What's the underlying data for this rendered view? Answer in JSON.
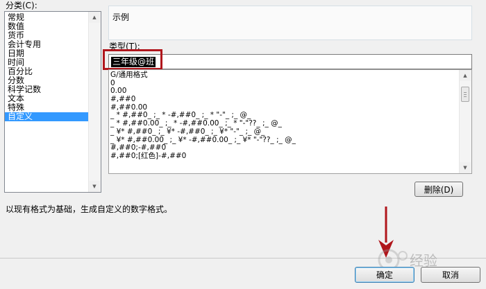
{
  "labels": {
    "category": "分类(C):",
    "sample": "示例",
    "type": "类型(T):",
    "description": "以现有格式为基础，生成自定义的数字格式。"
  },
  "categories": [
    "常规",
    "数值",
    "货币",
    "会计专用",
    "日期",
    "时间",
    "百分比",
    "分数",
    "科学记数",
    "文本",
    "特殊",
    "自定义"
  ],
  "selected_category": "自定义",
  "type_input": {
    "value": "三年级@班"
  },
  "formats": [
    "G/通用格式",
    "0",
    "0.00",
    "#,##0",
    "#,##0.00",
    "_ * #,##0_ ;_ * -#,##0_ ;_ * \"-\"_ ;_ @_",
    "_ * #,##0.00_ ;_ * -#,##0.00_ ;_ * \"-\"??_ ;_ @_",
    "_ ¥* #,##0_ ;_ ¥* -#,##0_ ;_ ¥* \"-\"_ ;_ @_",
    "_ ¥* #,##0.00_ ;_ ¥* -#,##0.00_ ;_ ¥* \"-\"??_ ;_ @_",
    "#,##0;-#,##0",
    "#,##0;[红色]-#,##0"
  ],
  "buttons": {
    "delete": "删除(D)",
    "ok": "确定",
    "cancel": "取消"
  },
  "watermark": {
    "text": "经验"
  },
  "colors": {
    "selection": "#3399ff",
    "highlight": "#b0161c",
    "arrow": "#b0161c"
  }
}
